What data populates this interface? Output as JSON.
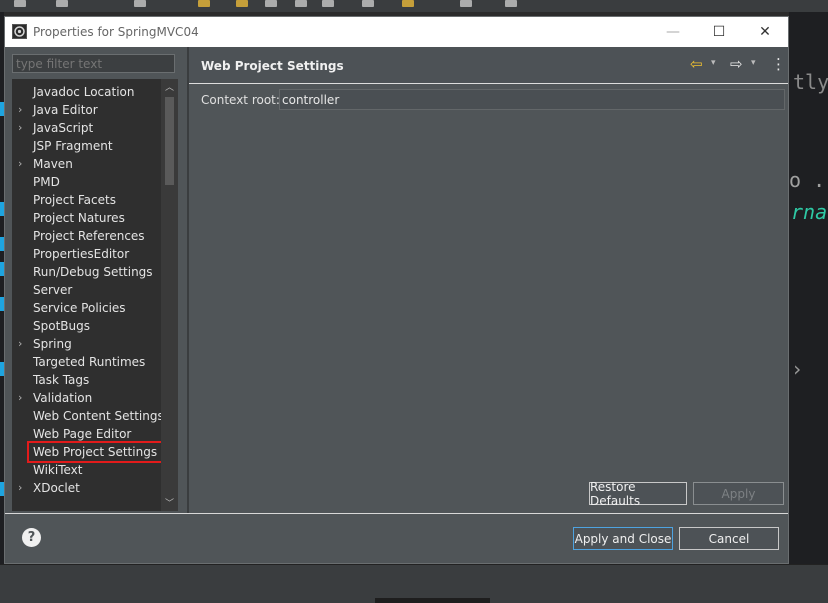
{
  "window": {
    "title": "Properties for SpringMVC04",
    "minimize_glyph": "—",
    "maximize_glyph": "☐",
    "close_glyph": "✕"
  },
  "filter": {
    "placeholder": "type filter text",
    "value": ""
  },
  "tree": {
    "items": [
      {
        "label": "Javadoc Location",
        "expandable": false
      },
      {
        "label": "Java Editor",
        "expandable": true
      },
      {
        "label": "JavaScript",
        "expandable": true
      },
      {
        "label": "JSP Fragment",
        "expandable": false
      },
      {
        "label": "Maven",
        "expandable": true
      },
      {
        "label": "PMD",
        "expandable": false
      },
      {
        "label": "Project Facets",
        "expandable": false
      },
      {
        "label": "Project Natures",
        "expandable": false
      },
      {
        "label": "Project References",
        "expandable": false
      },
      {
        "label": "PropertiesEditor",
        "expandable": false
      },
      {
        "label": "Run/Debug Settings",
        "expandable": false
      },
      {
        "label": "Server",
        "expandable": false
      },
      {
        "label": "Service Policies",
        "expandable": false
      },
      {
        "label": "SpotBugs",
        "expandable": false
      },
      {
        "label": "Spring",
        "expandable": true
      },
      {
        "label": "Targeted Runtimes",
        "expandable": false
      },
      {
        "label": "Task Tags",
        "expandable": false
      },
      {
        "label": "Validation",
        "expandable": true
      },
      {
        "label": "Web Content Settings",
        "expandable": false
      },
      {
        "label": "Web Page Editor",
        "expandable": false
      },
      {
        "label": "Web Project Settings",
        "expandable": false,
        "selected": true
      },
      {
        "label": "WikiText",
        "expandable": false
      },
      {
        "label": "XDoclet",
        "expandable": true
      }
    ]
  },
  "page": {
    "title": "Web Project Settings",
    "context_root_label": "Context root:",
    "context_root_value": "controller",
    "back_icon": "back-arrow-icon",
    "forward_icon": "forward-arrow-icon",
    "menu_icon": "more-vert-icon"
  },
  "buttons": {
    "restore_defaults": "Restore Defaults",
    "apply": "Apply",
    "apply_and_close": "Apply and Close",
    "cancel": "Cancel",
    "help": "?"
  },
  "background_editor": {
    "code_fragments": [
      "tly",
      "o .",
      "rna"
    ]
  },
  "colors": {
    "selection_outline": "#e21b1b",
    "nav_arrow": "#f2c230",
    "primary_button_border": "#4ea3e0",
    "editor_accent": "#2ec9a5"
  }
}
